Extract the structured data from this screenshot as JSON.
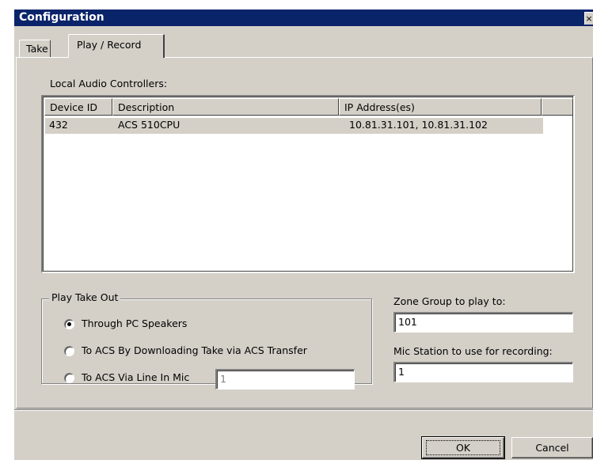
{
  "window": {
    "title": "Configuration",
    "close_glyph": "×"
  },
  "tabs": [
    {
      "label": "Take",
      "active": false
    },
    {
      "label": "Play / Record",
      "active": true
    }
  ],
  "local_audio": {
    "label": "Local Audio Controllers:",
    "columns": [
      "Device ID",
      "Description",
      "IP Address(es)"
    ],
    "rows": [
      {
        "device_id": "432",
        "description": "ACS 510CPU",
        "ip": "10.81.31.101,  10.81.31.102"
      }
    ]
  },
  "play_take_out": {
    "legend": "Play Take Out",
    "options": [
      {
        "label": "Through PC Speakers",
        "selected": true
      },
      {
        "label": "To ACS By Downloading Take via ACS Transfer",
        "selected": false
      },
      {
        "label": "To ACS Via Line In Mic",
        "selected": false
      }
    ],
    "line_in_mic_value": "1"
  },
  "zone_group": {
    "label": "Zone Group to play to:",
    "value": "101"
  },
  "mic_station": {
    "label": "Mic Station to use for recording:",
    "value": "1"
  },
  "buttons": {
    "ok": "OK",
    "cancel": "Cancel"
  }
}
